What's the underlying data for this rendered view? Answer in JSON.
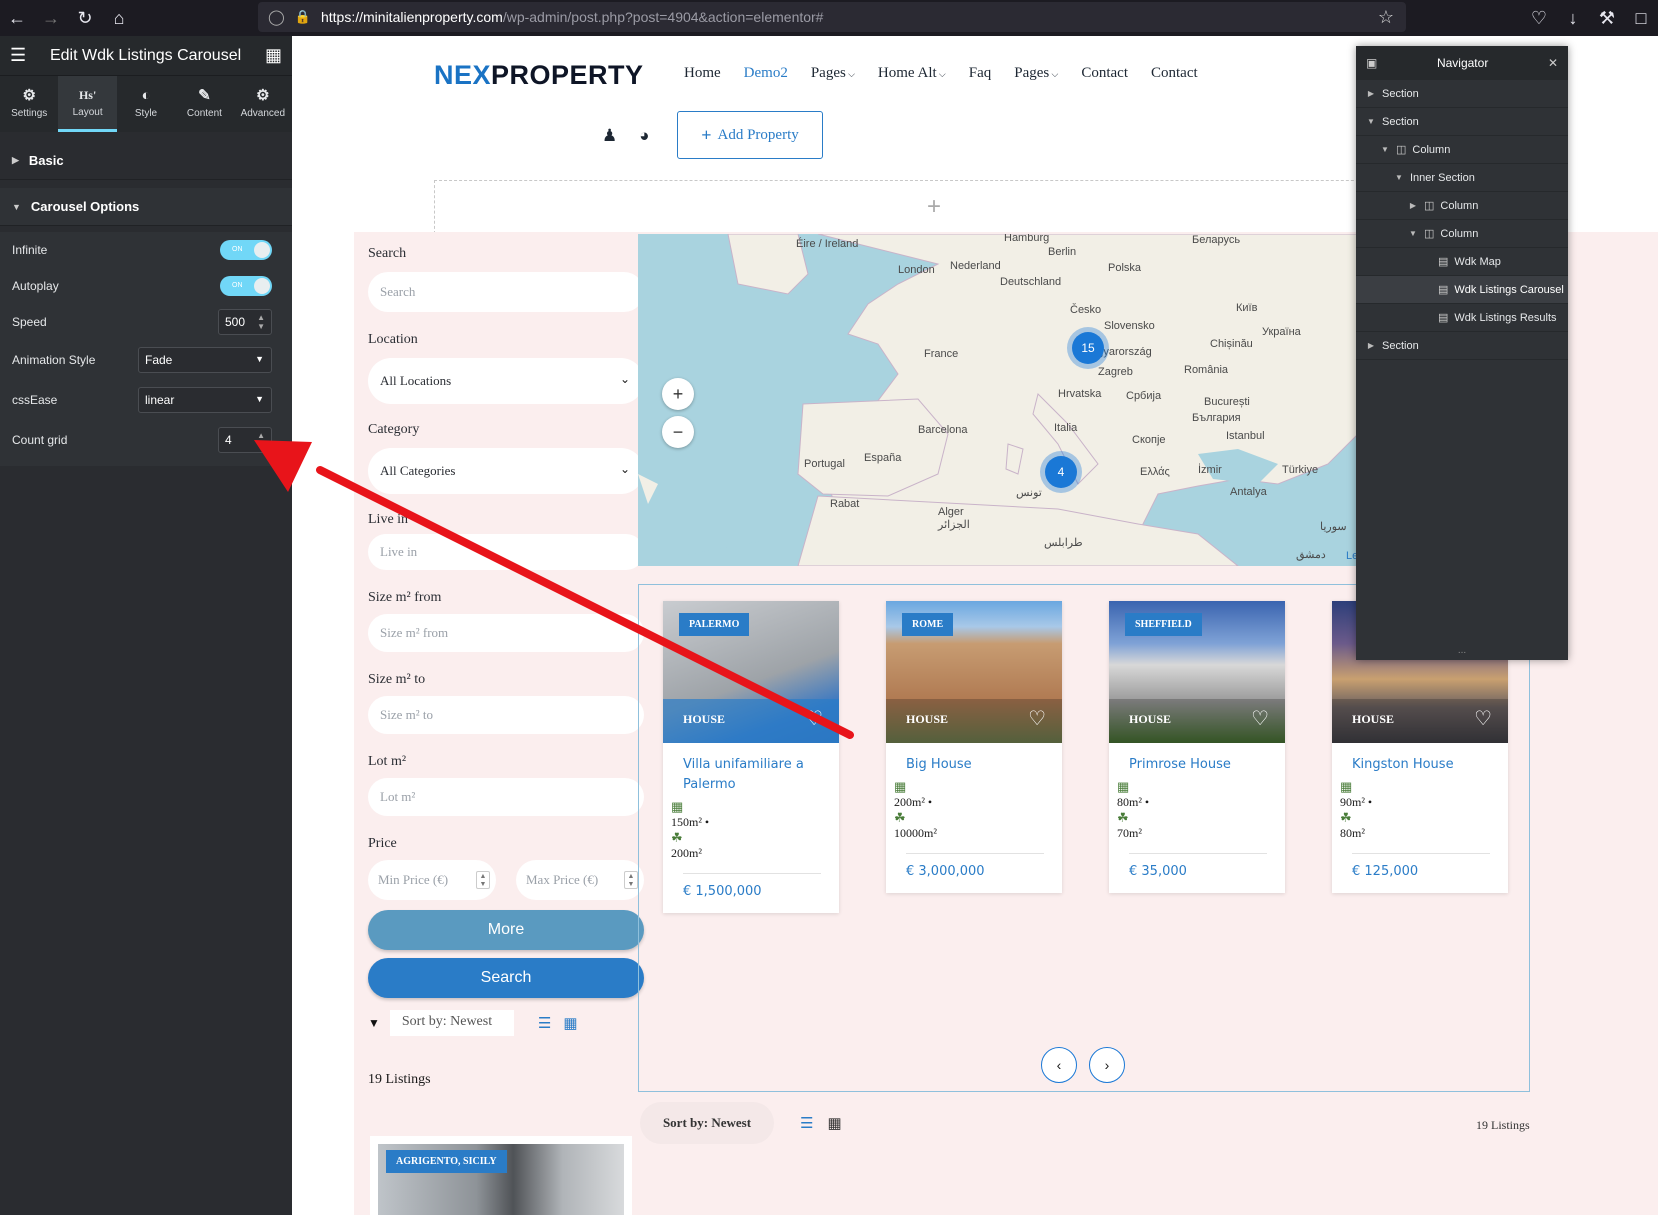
{
  "browser": {
    "url_domain": "https://minitalienproperty.com",
    "url_path": "/wp-admin/post.php?post=4904&action=elementor#"
  },
  "panel": {
    "title": "Edit Wdk Listings Carousel",
    "tabs": [
      {
        "label": "Settings",
        "icon": "settings-icon"
      },
      {
        "label": "Layout",
        "icon": "layout-icon",
        "glyph": "Hs'"
      },
      {
        "label": "Style",
        "icon": "style-icon"
      },
      {
        "label": "Content",
        "icon": "content-icon"
      },
      {
        "label": "Advanced",
        "icon": "advanced-icon"
      }
    ],
    "active_tab": "Layout",
    "section_basic": "Basic",
    "section_carousel": "Carousel Options",
    "controls": {
      "infinite_label": "Infinite",
      "infinite_state": "ON",
      "autoplay_label": "Autoplay",
      "autoplay_state": "ON",
      "speed_label": "Speed",
      "speed_value": "500",
      "animation_label": "Animation Style",
      "animation_value": "Fade",
      "cssease_label": "cssEase",
      "cssease_value": "linear",
      "countgrid_label": "Count grid",
      "countgrid_value": "4"
    }
  },
  "site": {
    "logo_part1": "NEX",
    "logo_part2": "PROPERTY",
    "menu": [
      "Home",
      "Demo2",
      "Pages",
      "Home Alt",
      "Faq",
      "Pages",
      "Contact",
      "Contact"
    ],
    "menu_active": "Demo2",
    "add_property": "Add Property"
  },
  "search_form": {
    "search_label": "Search",
    "search_placeholder": "Search",
    "location_label": "Location",
    "location_value": "All Locations",
    "category_label": "Category",
    "category_value": "All Categories",
    "livein_label": "Live in",
    "livein_placeholder": "Live in",
    "size_from_label": "Size m² from",
    "size_from_placeholder": "Size m² from",
    "size_to_label": "Size m² to",
    "size_to_placeholder": "Size m² to",
    "lot_label": "Lot m²",
    "lot_placeholder": "Lot m²",
    "price_label": "Price",
    "min_price_placeholder": "Min Price (€)",
    "max_price_placeholder": "Max Price (€)",
    "more_button": "More",
    "search_button": "Search",
    "sort_value": "Sort by: Newest",
    "listings_count": "19 Listings",
    "preview_tag": "AGRIGENTO, SICILY"
  },
  "map": {
    "labels": [
      "Éire / Ireland",
      "London",
      "Nederland",
      "Hamburg",
      "Berlin",
      "Polska",
      "Беларусь",
      "Deutschland",
      "Česko",
      "Київ",
      "France",
      "Slovensko",
      "Україна",
      "Magyarország",
      "Chișinău",
      "Zagreb",
      "România",
      "Hrvatska",
      "Србија",
      "București",
      "България",
      "Barcelona",
      "Italia",
      "Скопје",
      "Istanbul",
      "Portugal",
      "España",
      "Ελλάς",
      "İzmir",
      "Türkiye",
      "Antalya",
      "Rabat",
      "Alger",
      "الجزائر",
      "تونس",
      "طرابلس",
      "سوريا",
      "دمشق",
      "Le"
    ],
    "clusters": [
      {
        "count": "15"
      },
      {
        "count": "4"
      }
    ],
    "zoom_in": "+",
    "zoom_out": "−"
  },
  "carousel": {
    "cards": [
      {
        "city": "PALERMO",
        "type": "HOUSE",
        "title": "Villa unifamiliare a Palermo",
        "size1": "150m² •",
        "size2": "200m²",
        "price": "€ 1,500,000"
      },
      {
        "city": "ROME",
        "type": "HOUSE",
        "title": "Big House",
        "size1": "200m² •",
        "size2": "10000m²",
        "price": "€ 3,000,000"
      },
      {
        "city": "SHEFFIELD",
        "type": "HOUSE",
        "title": "Primrose House",
        "size1": "80m² •",
        "size2": "70m²",
        "price": "€ 35,000"
      },
      {
        "city": "",
        "type": "HOUSE",
        "title": "Kingston House",
        "size1": "90m² •",
        "size2": "80m²",
        "price": "€ 125,000"
      }
    ]
  },
  "bottom": {
    "sort_label": "Sort by:",
    "sort_value": "Newest",
    "count": "19 Listings"
  },
  "navigator": {
    "title": "Navigator",
    "items": [
      {
        "label": "Section",
        "depth": 0,
        "caret": "right",
        "icon": ""
      },
      {
        "label": "Section",
        "depth": 0,
        "caret": "down",
        "icon": ""
      },
      {
        "label": "Column",
        "depth": 1,
        "caret": "down",
        "icon": "column-icon"
      },
      {
        "label": "Inner Section",
        "depth": 2,
        "caret": "down",
        "icon": ""
      },
      {
        "label": "Column",
        "depth": 3,
        "caret": "right",
        "icon": "column-icon"
      },
      {
        "label": "Column",
        "depth": 3,
        "caret": "down",
        "icon": "column-icon"
      },
      {
        "label": "Wdk Map",
        "depth": 4,
        "caret": "",
        "icon": "widget-icon"
      },
      {
        "label": "Wdk Listings Carousel",
        "depth": 4,
        "caret": "",
        "icon": "widget-icon",
        "selected": true
      },
      {
        "label": "Wdk Listings Results",
        "depth": 4,
        "caret": "",
        "icon": "widget-icon"
      },
      {
        "label": "Section",
        "depth": 0,
        "caret": "right",
        "icon": ""
      }
    ]
  },
  "colors": {
    "accent": "#2a7cc7",
    "panel_bg": "#2a2c30",
    "toggle_on": "#71d7f7",
    "annotation_arrow": "#e8141a"
  }
}
